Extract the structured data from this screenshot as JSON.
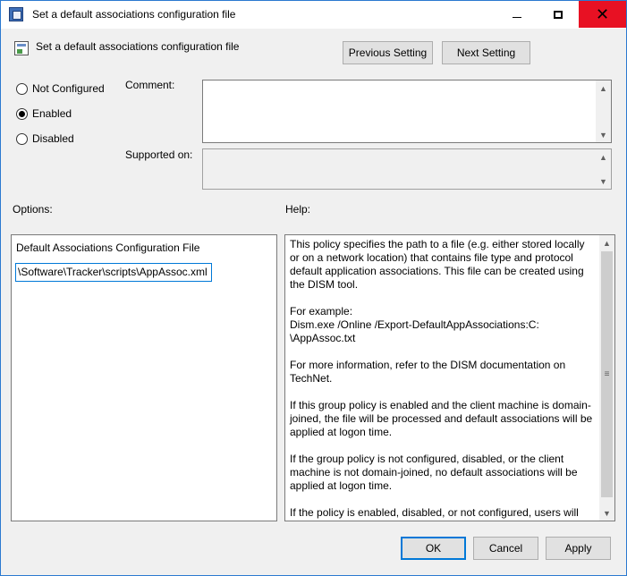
{
  "window": {
    "title": "Set a default associations configuration file",
    "close_glyph": "✕"
  },
  "header": {
    "setting_title": "Set a default associations configuration file",
    "previous_label": "Previous Setting",
    "next_label": "Next Setting"
  },
  "state": {
    "options": [
      {
        "label": "Not Configured",
        "checked": false
      },
      {
        "label": "Enabled",
        "checked": true
      },
      {
        "label": "Disabled",
        "checked": false
      }
    ]
  },
  "comment_label": "Comment:",
  "supported_label": "Supported on:",
  "options_label": "Options:",
  "help_label": "Help:",
  "options_panel": {
    "field_label": "Default Associations Configuration File",
    "field_value": "\\Software\\Tracker\\scripts\\AppAssoc.xml"
  },
  "help_paragraphs": [
    "This policy specifies the path to a file (e.g. either stored locally or on a network location) that contains file type and protocol default application associations. This file can be created using the DISM tool.",
    "For example:\nDism.exe /Online /Export-DefaultAppAssociations:C:\n\\AppAssoc.txt",
    "For more information, refer to the DISM documentation on TechNet.",
    "If this group policy is enabled and the client machine is domain-joined, the file will be processed and default associations will be applied at logon time.",
    "If the group policy is not configured, disabled, or the client machine is not domain-joined, no default associations will be applied at logon time.",
    "If the policy is enabled, disabled, or not configured, users will still"
  ],
  "footer": {
    "ok_label": "OK",
    "cancel_label": "Cancel",
    "apply_label": "Apply"
  },
  "icons": {
    "scroll_up": "▲",
    "scroll_down": "▼",
    "grip": "≡"
  },
  "colors": {
    "accent": "#0078d7",
    "close_hover": "#e81123",
    "dialog_bg": "#f0f0f0"
  }
}
